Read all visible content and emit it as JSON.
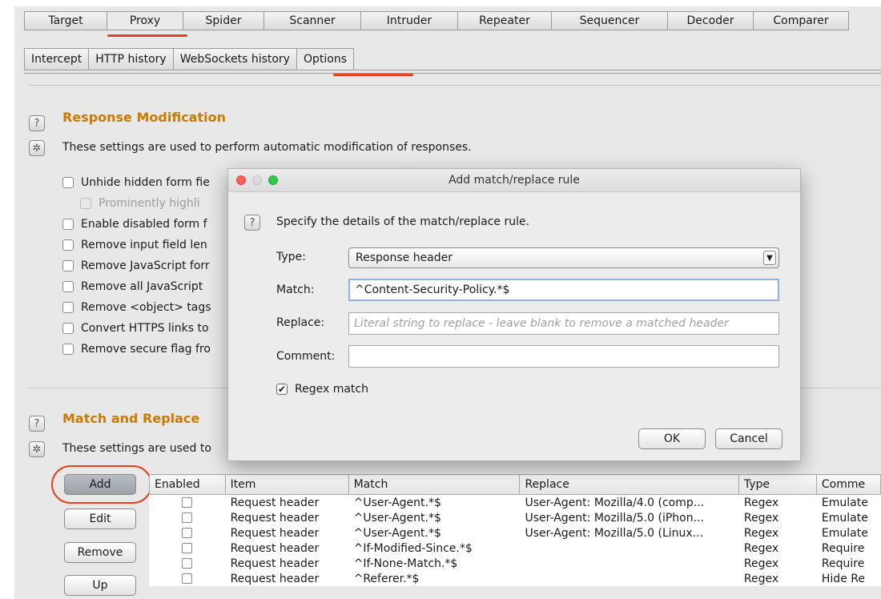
{
  "main_tabs": [
    {
      "label": "Target",
      "w": 104
    },
    {
      "label": "Proxy",
      "w": 96,
      "active": true
    },
    {
      "label": "Spider",
      "w": 102
    },
    {
      "label": "Scanner",
      "w": 122
    },
    {
      "label": "Intruder",
      "w": 122
    },
    {
      "label": "Repeater",
      "w": 118
    },
    {
      "label": "Sequencer",
      "w": 146
    },
    {
      "label": "Decoder",
      "w": 108
    },
    {
      "label": "Comparer",
      "w": 120
    }
  ],
  "sub_tabs": [
    {
      "label": "Intercept"
    },
    {
      "label": "HTTP history"
    },
    {
      "label": "WebSockets history"
    },
    {
      "label": "Options",
      "active": true
    }
  ],
  "response_mod": {
    "title": "Response Modification",
    "description": "These settings are used to perform automatic modification of responses.",
    "options": [
      {
        "label": "Unhide hidden form fie",
        "disabled": false
      },
      {
        "label": "Prominently highli",
        "disabled": true
      },
      {
        "label": "Enable disabled form f",
        "disabled": false
      },
      {
        "label": "Remove input field len",
        "disabled": false
      },
      {
        "label": "Remove JavaScript forr",
        "disabled": false
      },
      {
        "label": "Remove all JavaScript",
        "disabled": false
      },
      {
        "label": "Remove <object> tags",
        "disabled": false
      },
      {
        "label": "Convert HTTPS links to",
        "disabled": false
      },
      {
        "label": "Remove secure flag fro",
        "disabled": false
      }
    ]
  },
  "match_replace": {
    "title": "Match and Replace",
    "description": "These settings are used to",
    "buttons": {
      "add": "Add",
      "edit": "Edit",
      "remove": "Remove",
      "up": "Up"
    },
    "columns": [
      "Enabled",
      "Item",
      "Match",
      "Replace",
      "Type",
      "Comme"
    ],
    "rows": [
      {
        "item": "Request header",
        "match": "^User-Agent.*$",
        "replace": "User-Agent: Mozilla/4.0 (comp...",
        "type": "Regex",
        "comment": "Emulate"
      },
      {
        "item": "Request header",
        "match": "^User-Agent.*$",
        "replace": "User-Agent: Mozilla/5.0 (iPhon...",
        "type": "Regex",
        "comment": "Emulate"
      },
      {
        "item": "Request header",
        "match": "^User-Agent.*$",
        "replace": "User-Agent: Mozilla/5.0 (Linux...",
        "type": "Regex",
        "comment": "Emulate"
      },
      {
        "item": "Request header",
        "match": "^If-Modified-Since.*$",
        "replace": "",
        "type": "Regex",
        "comment": "Require"
      },
      {
        "item": "Request header",
        "match": "^If-None-Match.*$",
        "replace": "",
        "type": "Regex",
        "comment": "Require"
      },
      {
        "item": "Request header",
        "match": "^Referer.*$",
        "replace": "",
        "type": "Regex",
        "comment": "Hide Re"
      }
    ]
  },
  "dialog": {
    "title": "Add match/replace rule",
    "prompt": "Specify the details of the match/replace rule.",
    "type_label": "Type:",
    "type_value": "Response header",
    "match_label": "Match:",
    "match_value": "^Content-Security-Policy.*$",
    "replace_label": "Replace:",
    "replace_placeholder": "Literal string to replace - leave blank to remove a matched header",
    "comment_label": "Comment:",
    "comment_value": "",
    "regex_label": "Regex match",
    "regex_checked": true,
    "ok_label": "OK",
    "cancel_label": "Cancel"
  },
  "colors": {
    "accent": "#e8401c",
    "section_title": "#cc7a00"
  }
}
